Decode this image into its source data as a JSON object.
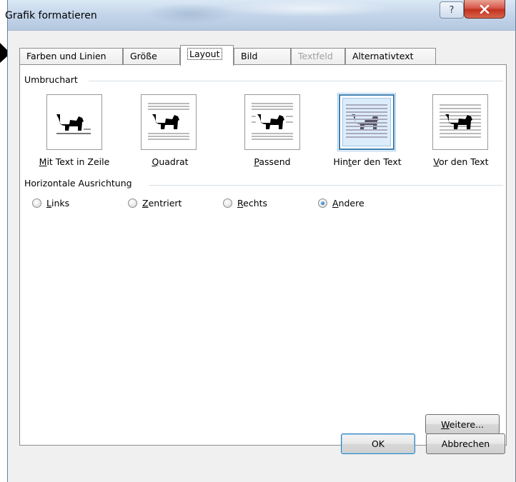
{
  "window": {
    "title": "Grafik formatieren",
    "help_symbol": "?",
    "close_symbol": "x"
  },
  "tabs": [
    {
      "label": "Farben und Linien",
      "state": "normal"
    },
    {
      "label": "Größe",
      "state": "normal"
    },
    {
      "label": "Layout",
      "state": "active"
    },
    {
      "label": "Bild",
      "state": "normal"
    },
    {
      "label": "Textfeld",
      "state": "disabled"
    },
    {
      "label": "Alternativtext",
      "state": "normal"
    }
  ],
  "wrap_group": {
    "label": "Umbruchart",
    "options": [
      {
        "pre": "",
        "u": "M",
        "post": "it Text in Zeile",
        "icon": "inline-dog-icon",
        "selected": false
      },
      {
        "pre": "",
        "u": "Q",
        "post": "uadrat",
        "icon": "square-wrap-dog-icon",
        "selected": false
      },
      {
        "pre": "",
        "u": "P",
        "post": "assend",
        "icon": "tight-wrap-dog-icon",
        "selected": false
      },
      {
        "pre": "Hin",
        "u": "t",
        "post": "er den Text",
        "icon": "behind-text-dog-icon",
        "selected": true
      },
      {
        "pre": "",
        "u": "V",
        "post": "or den Text",
        "icon": "in-front-dog-icon",
        "selected": false
      }
    ]
  },
  "align_group": {
    "label": "Horizontale Ausrichtung",
    "options": [
      {
        "pre": "",
        "u": "L",
        "post": "inks",
        "checked": false
      },
      {
        "pre": "",
        "u": "Z",
        "post": "entriert",
        "checked": false
      },
      {
        "pre": "",
        "u": "R",
        "post": "echts",
        "checked": false
      },
      {
        "pre": "",
        "u": "A",
        "post": "ndere",
        "checked": true
      }
    ]
  },
  "buttons": {
    "advanced": {
      "u": "W",
      "post": "eitere..."
    },
    "ok": "OK",
    "cancel": "Abbrechen"
  },
  "colors": {
    "accent": "#3c7fb1",
    "title_bar": "#c3d5ea",
    "close": "#c2321f"
  }
}
